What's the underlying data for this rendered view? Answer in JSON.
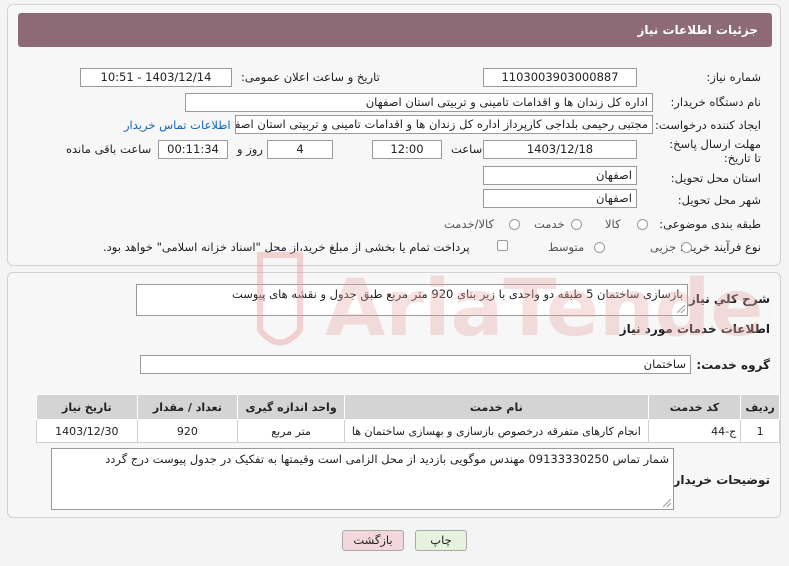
{
  "header": {
    "title": "جزئیات اطلاعات نیاز"
  },
  "fields": {
    "need_number_label": "شماره نیاز:",
    "need_number": "1103003903000887",
    "announce_label": "تاریخ و ساعت اعلان عمومی:",
    "announce_value": "1403/12/14 - 10:51",
    "buyer_label": "نام دستگاه خریدار:",
    "buyer_value": "اداره کل زندان ها و اقدامات تامینی و تربیتی استان اصفهان",
    "creator_label": "ایجاد کننده درخواست:",
    "creator_value": "مجتبی رحیمی بلداجی کارپرداز اداره کل زندان ها و اقدامات تامینی و تربیتی استان اصفهان",
    "contact_link": "اطلاعات تماس خریدار",
    "deadline_label": "مهلت ارسال پاسخ: تا تاریخ:",
    "deadline_date": "1403/12/18",
    "time_label": "ساعت",
    "deadline_time": "12:00",
    "days_value": "4",
    "days_label": "روز و",
    "remaining_value": "00:11:34",
    "remaining_label": "ساعت باقی مانده",
    "province_label": "استان محل تحویل:",
    "province_value": "اصفهان",
    "city_label": "شهر محل تحویل:",
    "city_value": "اصفهان",
    "category_label": "طبقه بندی موضوعی:",
    "category_options": [
      "کالا",
      "خدمت",
      "کالا/خدمت"
    ],
    "process_label": "نوع فرآیند خرید :",
    "process_options": [
      "جزیی",
      "متوسط"
    ],
    "payment_note": "پرداخت تمام یا بخشی از مبلغ خرید،از محل \"اسناد خزانه اسلامی\" خواهد بود."
  },
  "details": {
    "summary_label": "شرح كلي نياز:",
    "summary_value": "بازسازی ساختمان 5 طبقه دو واحدی با زیر بنای 920 متر مربع طبق جدول و نقشه های پیوست",
    "services_heading": "اطلاعات خدمات مورد نياز",
    "group_label": "گروه خدمت:",
    "group_value": "ساختمان",
    "table_headers": [
      "ردیف",
      "کد خدمت",
      "نام خدمت",
      "واحد اندازه گیری",
      "تعداد / مقدار",
      "تاریخ نیاز"
    ],
    "rows": [
      [
        "1",
        "ج-44",
        "انجام کارهای متفرقه درخصوص بازسازی و بهسازی ساختمان ها",
        "متر مربع",
        "920",
        "1403/12/30"
      ]
    ],
    "notes_label": "توضیحات خریدار:",
    "notes_value": "شمار تماس 09133330250 مهندس موگویی بازدید از محل الزامی است وقیمتها به تفکیک در جدول پیوست درج گردد"
  },
  "buttons": {
    "print": "چاپ",
    "back": "بازگشت"
  },
  "watermark": {
    "text": "AriaTender.neT"
  },
  "colors": {
    "header_bg": "#8e6a76",
    "link": "#1565c0",
    "back_button": "#f2d7dc",
    "print_button": "#e6f1de"
  }
}
